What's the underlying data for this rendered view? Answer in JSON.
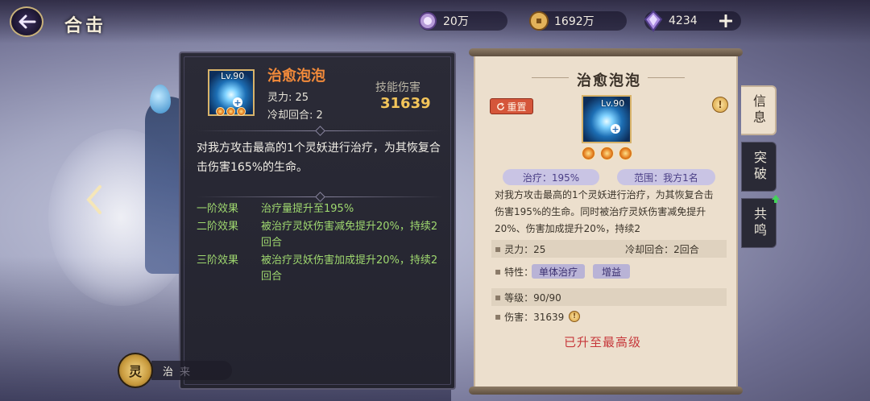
{
  "header": {
    "title": "合击",
    "resources": [
      {
        "name": "spirit-orb",
        "value": "20万"
      },
      {
        "name": "coin",
        "value": "1692万"
      },
      {
        "name": "crystal",
        "value": "4234"
      }
    ]
  },
  "skill": {
    "name": "治愈泡泡",
    "level": "Lv.90",
    "spirit_label": "灵力:",
    "spirit_value": "25",
    "cooldown_label": "冷却回合:",
    "cooldown_value": "2",
    "damage_label": "技能伤害",
    "damage_value": "31639",
    "description": "对我方攻击最高的1个灵妖进行治疗，为其恢复合击伤害165%的生命。",
    "effects": [
      {
        "tier": "一阶效果",
        "text": "治疗量提升至195%"
      },
      {
        "tier": "二阶效果",
        "text": "被治疗灵妖伤害减免提升20%，持续2回合"
      },
      {
        "tier": "三阶效果",
        "text": "被治疗灵妖伤害加成提升20%，持续2回合"
      }
    ]
  },
  "bottom": {
    "badge": "灵",
    "label": "治",
    "label_dim": "来"
  },
  "detail": {
    "title": "治愈泡泡",
    "reset_label": "重置",
    "info_icon_text": "!",
    "level": "Lv.90",
    "heal_tag": "治疗：195%",
    "range_tag": "范围：我方1名",
    "description": "对我方攻击最高的1个灵妖进行治疗，为其恢复合击伤害195%的生命。同时被治疗灵妖伤害减免提升20%、伤害加成提升20%，持续2",
    "spirit": "灵力：25",
    "cooldown": "冷却回合：2回合",
    "traits_label": "特性：",
    "traits": [
      "单体治疗",
      "增益"
    ],
    "grade": "等级：90/90",
    "damage": "伤害：31639",
    "status": "已升至最高级"
  },
  "tabs": [
    {
      "label": "信息",
      "active": true
    },
    {
      "label": "突破",
      "active": false
    },
    {
      "label": "共鸣",
      "active": false
    }
  ]
}
